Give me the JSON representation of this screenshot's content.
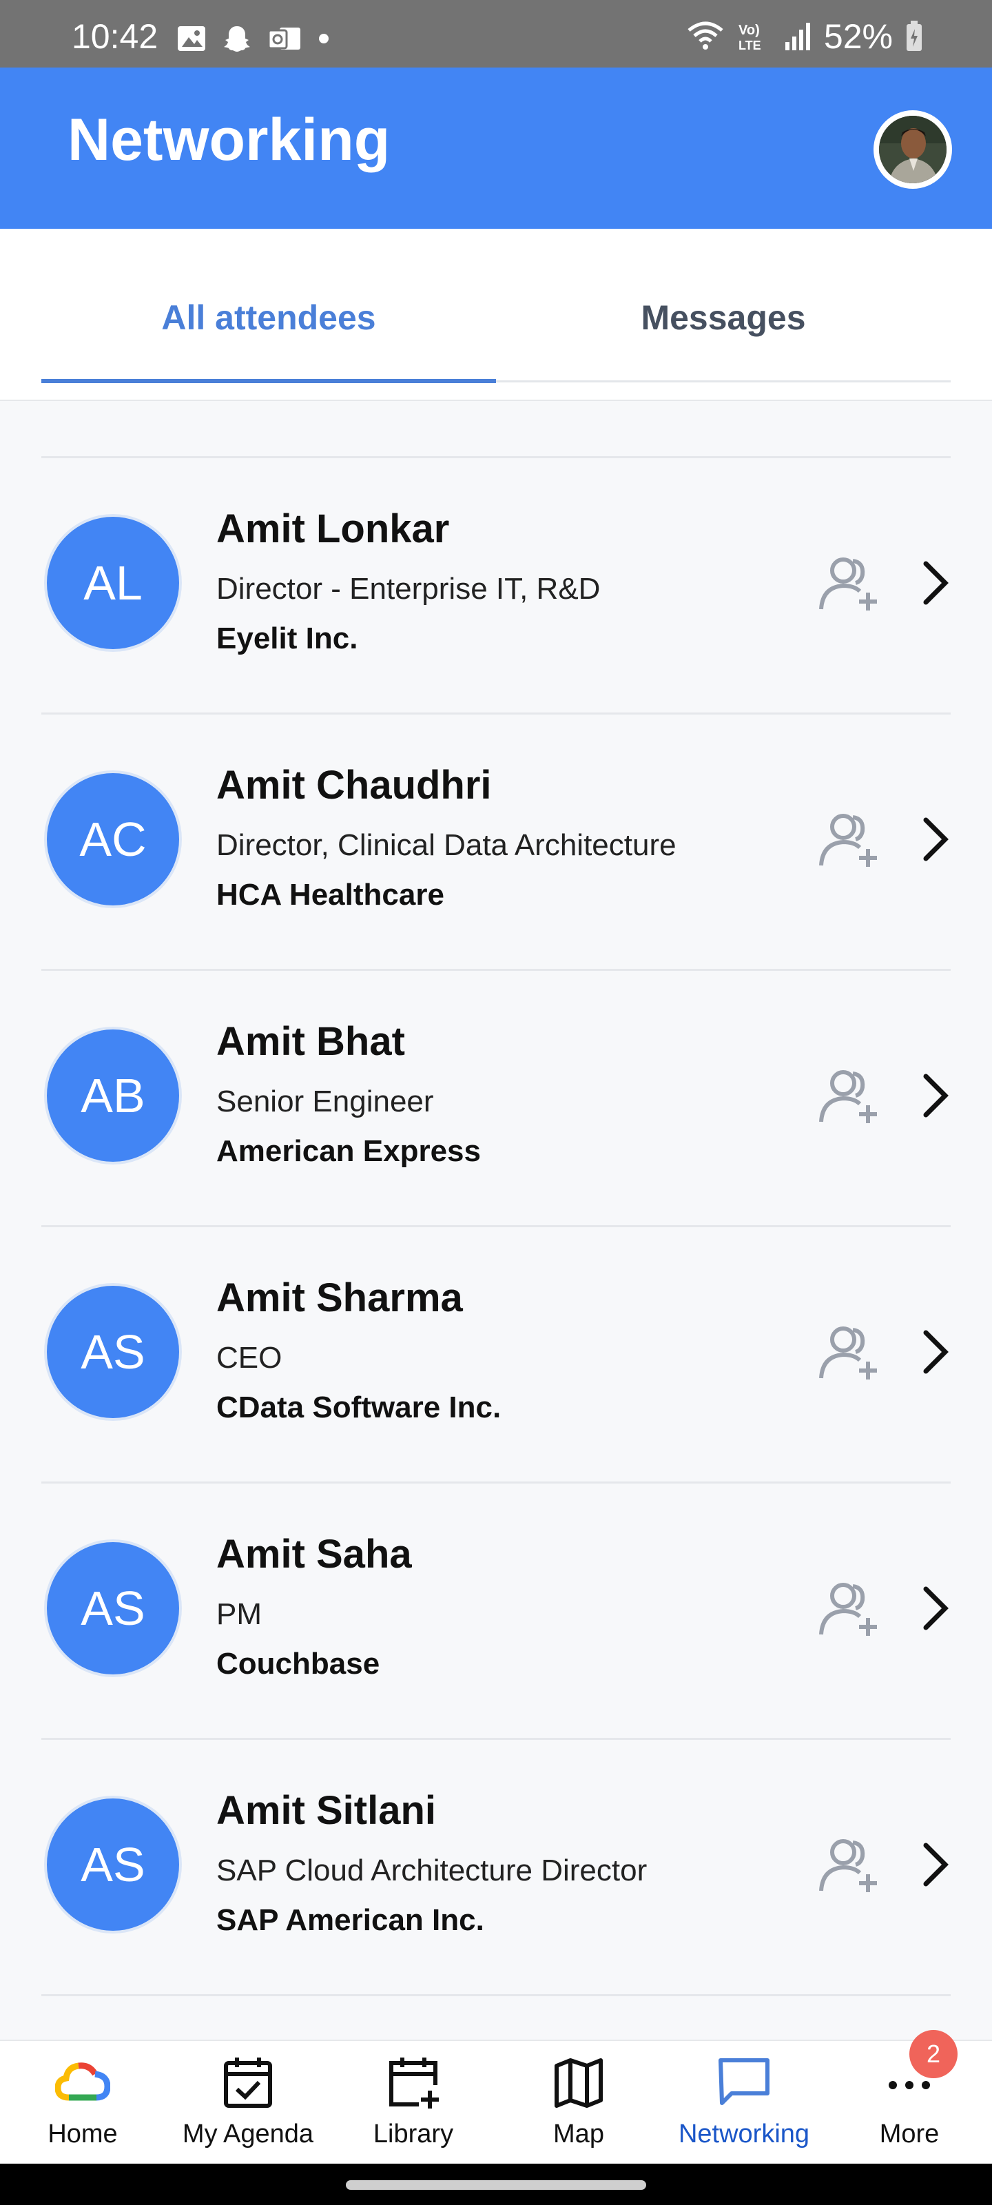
{
  "status_bar": {
    "time": "10:42",
    "battery": "52%",
    "left_icons": [
      "image-icon",
      "snapchat-icon",
      "outlook-icon",
      "dot-icon"
    ],
    "right_icons": [
      "wifi-icon",
      "volte-icon",
      "signal-icon",
      "battery-icon"
    ]
  },
  "header": {
    "title": "Networking"
  },
  "tabs": [
    {
      "label": "All attendees",
      "active": true
    },
    {
      "label": "Messages",
      "active": false
    }
  ],
  "attendees": [
    {
      "initials": "AL",
      "name": "Amit Lonkar",
      "title": "Director - Enterprise IT, R&D",
      "company": "Eyelit Inc."
    },
    {
      "initials": "AC",
      "name": "Amit Chaudhri",
      "title": "Director, Clinical Data Architecture",
      "company": "HCA Healthcare"
    },
    {
      "initials": "AB",
      "name": "Amit Bhat",
      "title": "Senior Engineer",
      "company": "American Express"
    },
    {
      "initials": "AS",
      "name": "Amit Sharma",
      "title": "CEO",
      "company": "CData Software Inc."
    },
    {
      "initials": "AS",
      "name": "Amit Saha",
      "title": "PM",
      "company": "Couchbase"
    },
    {
      "initials": "AS",
      "name": "Amit Sitlani",
      "title": "SAP Cloud Architecture Director",
      "company": "SAP American Inc."
    }
  ],
  "bottom_nav": {
    "items": [
      {
        "label": "Home",
        "icon": "google-cloud-icon"
      },
      {
        "label": "My Agenda",
        "icon": "calendar-check-icon"
      },
      {
        "label": "Library",
        "icon": "calendar-plus-icon"
      },
      {
        "label": "Map",
        "icon": "map-icon"
      },
      {
        "label": "Networking",
        "icon": "chat-icon",
        "active": true
      },
      {
        "label": "More",
        "icon": "more-icon"
      }
    ],
    "more_badge": "2"
  },
  "colors": {
    "primary": "#4285f4",
    "tab_active": "#4a7fd8",
    "badge": "#f0645a"
  }
}
